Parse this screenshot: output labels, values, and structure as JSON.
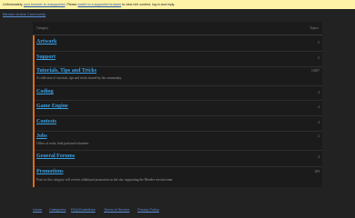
{
  "banner": {
    "text_1": "Unfortunately,",
    "link_1": "your browser is unsupported",
    "text_2": ". Please",
    "link_2": "switch to a supported browser",
    "text_3": "to view rich content, log in and reply."
  },
  "site_link": "Blender Artists Community",
  "table": {
    "col_category": "Category",
    "col_topics": "Topics",
    "rows": [
      {
        "name": "Artwork",
        "description": "",
        "count": "5"
      },
      {
        "name": "Support",
        "description": "",
        "count": "5"
      },
      {
        "name": "Tutorials, Tips and Tricks",
        "description": "A collection of tutorials, tips and tricks shared by the community.",
        "count": "10187"
      },
      {
        "name": "Coding",
        "description": "",
        "count": "4"
      },
      {
        "name": "Game Engine",
        "description": "",
        "count": "4"
      },
      {
        "name": "Contests",
        "description": "",
        "count": "4"
      },
      {
        "name": "Jobs",
        "description": "Offers of work, both paid and volunteer.",
        "count": "2"
      },
      {
        "name": "General Forums",
        "description": "",
        "count": "4"
      },
      {
        "name": "Promotions",
        "description": "Posts in this category will receive additional promotion on the site, supporting the Blender version team",
        "count": "209"
      }
    ]
  },
  "footer": {
    "links": [
      "Home",
      "Categories",
      "FAQ/Guidelines",
      "Terms of Service",
      "Privacy Policy"
    ]
  },
  "colors": {
    "accent_bar": "#e36a12",
    "link": "#3aa0e4"
  }
}
